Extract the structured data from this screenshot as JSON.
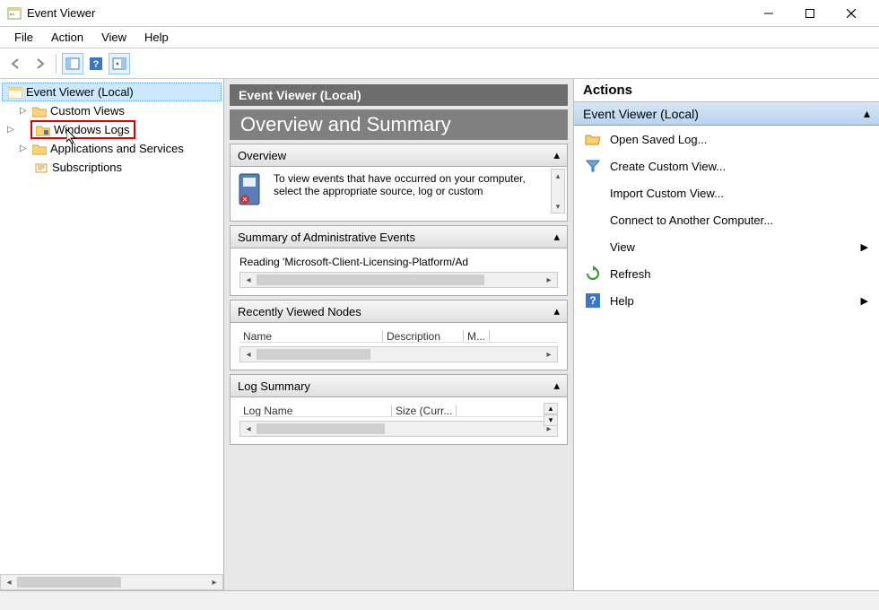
{
  "titlebar": {
    "title": "Event Viewer"
  },
  "menubar": [
    "File",
    "Action",
    "View",
    "Help"
  ],
  "toolbar": {
    "back": "back-arrow-icon",
    "forward": "forward-arrow-icon",
    "show_hide": "show-hide-console-tree-icon",
    "help": "help-icon",
    "preview": "preview-pane-icon"
  },
  "tree": {
    "root": "Event Viewer (Local)",
    "items": [
      {
        "label": "Custom Views",
        "expandable": true
      },
      {
        "label": "Windows Logs",
        "expandable": true,
        "highlighted": true
      },
      {
        "label": "Applications and Services",
        "expandable": true
      },
      {
        "label": "Subscriptions",
        "expandable": false
      }
    ]
  },
  "middle": {
    "header": "Event Viewer (Local)",
    "subheader": "Overview and Summary",
    "sections": {
      "overview": {
        "title": "Overview",
        "text": "To view events that have occurred on your computer, select the appropriate source, log or custom"
      },
      "admin_summary": {
        "title": "Summary of Administrative Events",
        "text": "Reading 'Microsoft-Client-Licensing-Platform/Ad"
      },
      "recent": {
        "title": "Recently Viewed Nodes",
        "cols": [
          "Name",
          "Description",
          "M..."
        ]
      },
      "log_summary": {
        "title": "Log Summary",
        "cols": [
          "Log Name",
          "Size (Curr..."
        ]
      }
    }
  },
  "actions": {
    "title": "Actions",
    "subtitle": "Event Viewer (Local)",
    "items": [
      {
        "label": "Open Saved Log...",
        "icon": "folder-open-icon"
      },
      {
        "label": "Create Custom View...",
        "icon": "filter-icon"
      },
      {
        "label": "Import Custom View...",
        "icon": "blank-icon"
      },
      {
        "label": "Connect to Another Computer...",
        "icon": "blank-icon"
      },
      {
        "label": "View",
        "icon": "blank-icon",
        "submenu": true
      },
      {
        "label": "Refresh",
        "icon": "refresh-icon"
      },
      {
        "label": "Help",
        "icon": "help-icon",
        "submenu": true
      }
    ]
  }
}
